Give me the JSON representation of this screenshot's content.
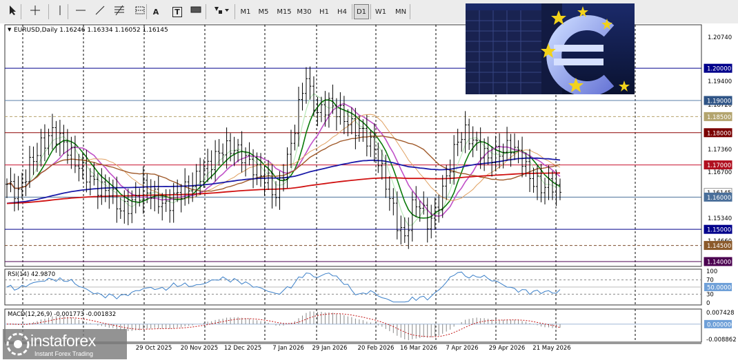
{
  "toolbar": {
    "tools": [
      {
        "name": "cursor-icon"
      },
      {
        "name": "crosshair-icon"
      },
      {
        "name": "vertical-line-icon"
      },
      {
        "name": "horizontal-line-icon"
      },
      {
        "name": "trend-line-icon"
      },
      {
        "name": "fibonacci-icon"
      },
      {
        "name": "channel-icon"
      },
      {
        "name": "text-icon",
        "label": "A"
      },
      {
        "name": "text-label-icon",
        "label": "T"
      },
      {
        "name": "rectangle-icon"
      },
      {
        "name": "shapes-dropdown-icon"
      }
    ],
    "timeframes": [
      "M1",
      "M5",
      "M15",
      "M30",
      "H1",
      "H4",
      "D1",
      "W1",
      "MN"
    ],
    "active_timeframe": "D1"
  },
  "chart_data": {
    "type": "line",
    "symbol_header": "EURUSD,Daily",
    "ohlc": [
      "1.16246",
      "1.16334",
      "1.16052",
      "1.16145"
    ],
    "price_scale": [
      "1.20740",
      "1.19400",
      "1.18720",
      "1.17360",
      "1.16700",
      "1.16700",
      "1.15340",
      "1.14660"
    ],
    "price_ylim": [
      1.1385,
      1.2135
    ],
    "x_labels": [
      "29 Oct 2025",
      "20 Nov 2025",
      "12 Dec 2025",
      "7 Jan 2026",
      "29 Jan 2026",
      "20 Feb 2026",
      "16 Mar 2026",
      "7 Apr 2026",
      "29 Apr 2026",
      "21 May 2026"
    ],
    "levels": [
      {
        "label": "1.20000",
        "value": 1.2,
        "color": "#00008b",
        "bg": "#00008b",
        "fg": "#ffffff",
        "style": "solid"
      },
      {
        "label": "1.19000",
        "value": 1.19,
        "color": "#5a7fa8",
        "bg": "#2f5486",
        "fg": "#ffffff",
        "style": "solid"
      },
      {
        "label": "1.18500",
        "value": 1.185,
        "color": "#b5a06a",
        "bg": "#b3a46e",
        "fg": "#ffffff",
        "style": "dashed"
      },
      {
        "label": "1.18000",
        "value": 1.18,
        "color": "#8b0000",
        "bg": "#7a0000",
        "fg": "#ffffff",
        "style": "solid"
      },
      {
        "label": "1.17000",
        "value": 1.17,
        "color": "#c8102e",
        "bg": "#b01020",
        "fg": "#ffffff",
        "style": "solid"
      },
      {
        "label": "1.16145",
        "value": 1.16145,
        "color": "#bbbbbb",
        "bg": "#ffffff",
        "fg": "#000000",
        "style": "none"
      },
      {
        "label": "1.16000",
        "value": 1.16,
        "color": "#4a6f9a",
        "bg": "#4a6f9a",
        "fg": "#ffffff",
        "style": "solid"
      },
      {
        "label": "1.15000",
        "value": 1.15,
        "color": "#00008b",
        "bg": "#00008b",
        "fg": "#ffffff",
        "style": "solid"
      },
      {
        "label": "1.14500",
        "value": 1.145,
        "color": "#7b4a2a",
        "bg": "#8b5a2b",
        "fg": "#ffffff",
        "style": "dashed"
      },
      {
        "label": "1.14000",
        "value": 1.14,
        "color": "#4b0050",
        "bg": "#4b0050",
        "fg": "#ffffff",
        "style": "solid"
      }
    ],
    "anchors": [
      [
        0,
        1.164
      ],
      [
        3,
        1.161
      ],
      [
        6,
        1.17
      ],
      [
        9,
        1.176
      ],
      [
        12,
        1.18
      ],
      [
        15,
        1.177
      ],
      [
        18,
        1.171
      ],
      [
        21,
        1.167
      ],
      [
        24,
        1.163
      ],
      [
        27,
        1.162
      ],
      [
        30,
        1.156
      ],
      [
        33,
        1.158
      ],
      [
        36,
        1.163
      ],
      [
        39,
        1.16
      ],
      [
        42,
        1.157
      ],
      [
        45,
        1.161
      ],
      [
        48,
        1.163
      ],
      [
        51,
        1.167
      ],
      [
        54,
        1.171
      ],
      [
        57,
        1.175
      ],
      [
        60,
        1.175
      ],
      [
        63,
        1.172
      ],
      [
        66,
        1.168
      ],
      [
        69,
        1.165
      ],
      [
        71,
        1.16
      ],
      [
        73,
        1.168
      ],
      [
        75,
        1.176
      ],
      [
        77,
        1.188
      ],
      [
        79,
        1.198
      ],
      [
        80,
        1.192
      ],
      [
        82,
        1.186
      ],
      [
        85,
        1.189
      ],
      [
        88,
        1.186
      ],
      [
        91,
        1.182
      ],
      [
        94,
        1.18
      ],
      [
        97,
        1.175
      ],
      [
        99,
        1.168
      ],
      [
        101,
        1.16
      ],
      [
        103,
        1.152
      ],
      [
        105,
        1.147
      ],
      [
        107,
        1.157
      ],
      [
        109,
        1.158
      ],
      [
        111,
        1.152
      ],
      [
        113,
        1.155
      ],
      [
        115,
        1.162
      ],
      [
        117,
        1.17
      ],
      [
        119,
        1.178
      ],
      [
        121,
        1.18
      ],
      [
        124,
        1.176
      ],
      [
        127,
        1.172
      ],
      [
        130,
        1.174
      ],
      [
        133,
        1.176
      ],
      [
        136,
        1.172
      ],
      [
        138,
        1.166
      ],
      [
        141,
        1.163
      ],
      [
        144,
        1.164
      ],
      [
        146,
        1.1615
      ]
    ],
    "ma_periods": [
      {
        "period": 5,
        "color": "#b8e8b8",
        "width": 1.2
      },
      {
        "period": 8,
        "color": "#0a7a0a",
        "width": 1.6
      },
      {
        "period": 13,
        "color": "#c050c8",
        "width": 1.6
      },
      {
        "period": 21,
        "color": "#e0a060",
        "width": 1.0
      },
      {
        "period": 34,
        "color": "#a05a2a",
        "width": 1.4
      },
      {
        "period": 89,
        "color": "#1a1aa8",
        "width": 1.8
      },
      {
        "period": 200,
        "color": "#d01010",
        "width": 1.8
      }
    ],
    "rsi": {
      "label": "RSI(14) 42.9870",
      "value": 42.987,
      "ylim": [
        0,
        100
      ],
      "scale": [
        "100",
        "70",
        "30",
        "0"
      ],
      "marker": "50.0000",
      "color": "#3a7fc8"
    },
    "macd": {
      "label": "MACD(12,26,9) -0.001773 -0.001832",
      "scale_top": "0.007428",
      "scale_bottom": "-0.008862",
      "zero_label": "0.000000",
      "ylim": [
        -0.008862,
        0.007428
      ],
      "hist_color": "#888888",
      "signal_color": "#c01010"
    }
  },
  "watermark": {
    "brand": "instaforex",
    "tagline": "Instant Forex Trading"
  },
  "photo": {
    "alt": "ECB euro sign sculpture"
  }
}
